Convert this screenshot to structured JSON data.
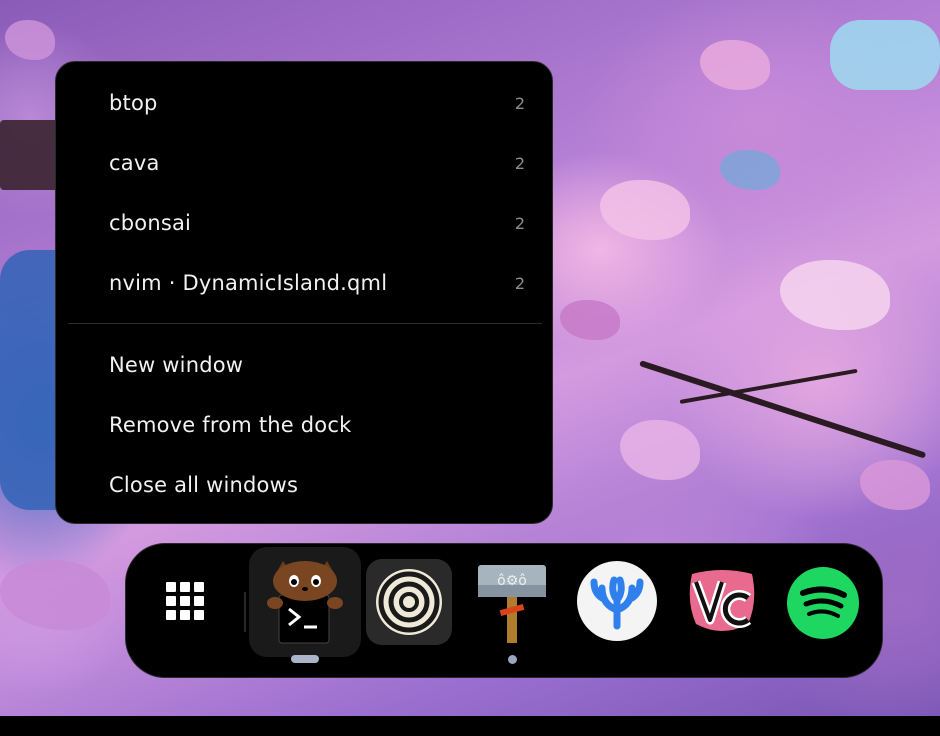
{
  "menu": {
    "windows": [
      {
        "label": "btop",
        "count": "2"
      },
      {
        "label": "cava",
        "count": "2"
      },
      {
        "label": "cbonsai",
        "count": "2"
      },
      {
        "label": "nvim · DynamicIsland.qml",
        "count": "2"
      }
    ],
    "actions": [
      {
        "label": "New window"
      },
      {
        "label": "Remove from the dock"
      },
      {
        "label": "Close all windows"
      }
    ]
  },
  "dock": {
    "apps": [
      {
        "name": "app-grid-icon"
      },
      {
        "name": "terminal-icon",
        "running": true,
        "focused": true
      },
      {
        "name": "target-rings-icon"
      },
      {
        "name": "hammer-icon",
        "running": true
      },
      {
        "name": "vscodium-icon"
      },
      {
        "name": "vesktop-icon"
      },
      {
        "name": "spotify-icon"
      }
    ],
    "colors": {
      "spotify": "#1ed760",
      "vscodium": "#2f80ed",
      "vesktop": "#e86b8f",
      "indicator": "#a9b4c8"
    }
  }
}
